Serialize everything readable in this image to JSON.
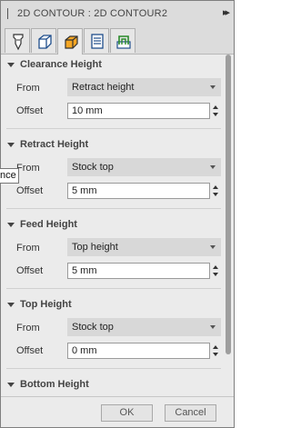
{
  "window": {
    "title": "2D CONTOUR : 2D CONTOUR2",
    "expand_glyph": "▸▸"
  },
  "tabs": [
    {
      "icon": "tool-icon",
      "active": false
    },
    {
      "icon": "geometry-icon",
      "active": false
    },
    {
      "icon": "heights-icon",
      "active": true
    },
    {
      "icon": "passes-icon",
      "active": false
    },
    {
      "icon": "linking-icon",
      "active": false
    }
  ],
  "labels": {
    "from": "From",
    "offset": "Offset"
  },
  "sections": {
    "clearance": {
      "title": "Clearance Height",
      "from": "Retract height",
      "offset": "10 mm"
    },
    "retract": {
      "title": "Retract Height",
      "from": "Stock top",
      "offset": "5 mm"
    },
    "feed": {
      "title": "Feed Height",
      "from": "Top height",
      "offset": "5 mm"
    },
    "top": {
      "title": "Top Height",
      "from": "Stock top",
      "offset": "0 mm"
    },
    "bottom": {
      "title": "Bottom Height"
    }
  },
  "tooltip": {
    "text": "nce"
  },
  "footer": {
    "ok_label": "OK",
    "cancel_label": "Cancel"
  },
  "colors": {
    "panel_bg": "#ebebeb",
    "titlebar_bg": "#dcdcdc",
    "dropdown_bg": "#d8d8d8",
    "active_tab_icon": "#f5a623"
  }
}
